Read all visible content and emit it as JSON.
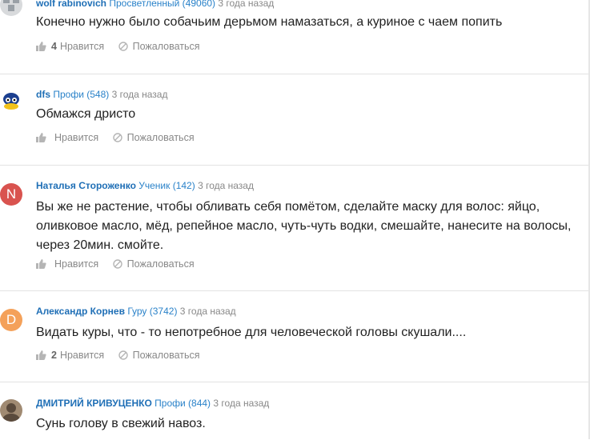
{
  "answers": [
    {
      "author": "wolf rabinovich",
      "rank": "Просветленный (49060)",
      "time": "3 года назад",
      "text": "Конечно нужно было собачьим дерьмом намазаться, а куриное с чаем попить",
      "likes_count": "4",
      "like_label": "Нравится",
      "report_label": "Пожаловаться",
      "avatar": {
        "type": "image",
        "colors": [
          "#9aa0a6",
          "#d8dadc"
        ]
      }
    },
    {
      "author": "dfs",
      "rank": "Профи (548)",
      "time": "3 года назад",
      "text": "Обмажся дристо",
      "likes_count": "",
      "like_label": "Нравится",
      "report_label": "Пожаловаться",
      "avatar": {
        "type": "image",
        "colors": [
          "#1c3f8f",
          "#f2c21b"
        ]
      }
    },
    {
      "author": "Наталья Стороженко",
      "rank": "Ученик (142)",
      "time": "3 года назад",
      "text": "Вы же не растение, чтобы обливать себя помётом, сделайте маску для волос: яйцо, оливковое масло, мёд, репейное масло, чуть-чуть водки, смешайте, нанесите на волосы, через 20мин. смойте.",
      "likes_count": "",
      "like_label": "Нравится",
      "report_label": "Пожаловаться",
      "avatar": {
        "type": "letter",
        "letter": "N",
        "color": "#d9534f"
      }
    },
    {
      "author": "Александр Корнев",
      "rank": "Гуру (3742)",
      "time": "3 года назад",
      "text": "Видать куры, что - то непотребное для человеческой головы скушали....",
      "likes_count": "2",
      "like_label": "Нравится",
      "report_label": "Пожаловаться",
      "avatar": {
        "type": "letter",
        "letter": "D",
        "color": "#f4a15a"
      }
    },
    {
      "author": "ДМИТРИЙ КРИВУЦЕНКО",
      "rank": "Профи (844)",
      "time": "3 года назад",
      "text": "Сунь голову в свежий навоз.",
      "likes_count": "",
      "like_label": "Нравится",
      "report_label": "Пожаловаться",
      "avatar": {
        "type": "image",
        "colors": [
          "#5a4a3c",
          "#a08a72"
        ]
      }
    }
  ]
}
